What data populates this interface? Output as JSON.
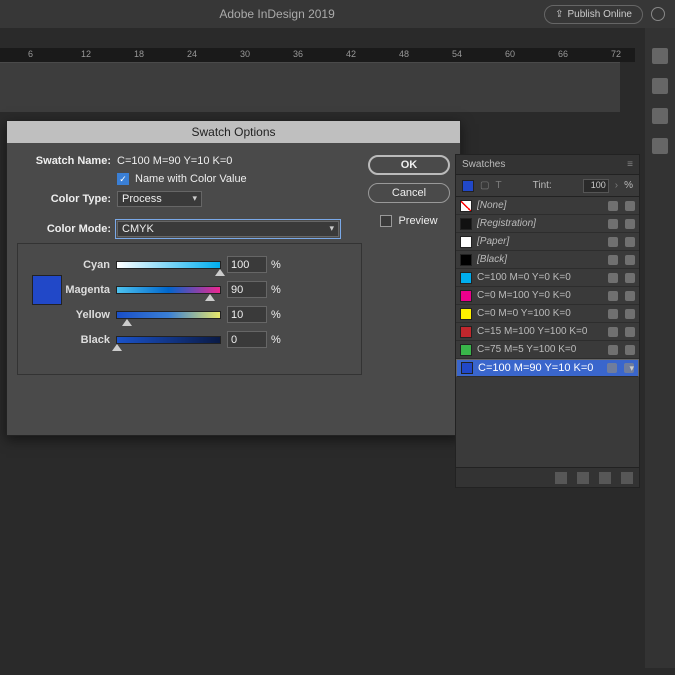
{
  "app": {
    "title": "Adobe InDesign 2019",
    "publish": "Publish Online"
  },
  "ruler": {
    "marks": [
      "6",
      "12",
      "18",
      "24",
      "30",
      "36",
      "42",
      "48",
      "54",
      "60",
      "66",
      "72"
    ]
  },
  "dialog": {
    "title": "Swatch Options",
    "name_label": "Swatch Name:",
    "name_value": "C=100 M=90 Y=10 K=0",
    "name_with_value": "Name with Color Value",
    "color_type_label": "Color Type:",
    "color_type_value": "Process",
    "color_mode_label": "Color Mode:",
    "color_mode_value": "CMYK",
    "channels": {
      "cyan": {
        "label": "Cyan",
        "value": "100"
      },
      "magenta": {
        "label": "Magenta",
        "value": "90"
      },
      "yellow": {
        "label": "Yellow",
        "value": "10"
      },
      "black": {
        "label": "Black",
        "value": "0"
      }
    },
    "pct": "%",
    "ok": "OK",
    "cancel": "Cancel",
    "preview": "Preview",
    "preview_hex": "#2148c8"
  },
  "swatches": {
    "title": "Swatches",
    "tint_label": "Tint:",
    "tint_value": "100",
    "tint_pct": "%",
    "items": [
      {
        "name": "[None]",
        "hex": "transparent"
      },
      {
        "name": "[Registration]",
        "hex": "#111"
      },
      {
        "name": "[Paper]",
        "hex": "#fff"
      },
      {
        "name": "[Black]",
        "hex": "#000"
      },
      {
        "name": "C=100 M=0 Y=0 K=0",
        "hex": "#00aeef"
      },
      {
        "name": "C=0 M=100 Y=0 K=0",
        "hex": "#ec008c"
      },
      {
        "name": "C=0 M=0 Y=100 K=0",
        "hex": "#fff200"
      },
      {
        "name": "C=15 M=100 Y=100 K=0",
        "hex": "#c1272d"
      },
      {
        "name": "C=75 M=5 Y=100 K=0",
        "hex": "#39b54a"
      },
      {
        "name": "C=100 M=90 Y=10 K=0",
        "hex": "#2148c8"
      }
    ]
  }
}
